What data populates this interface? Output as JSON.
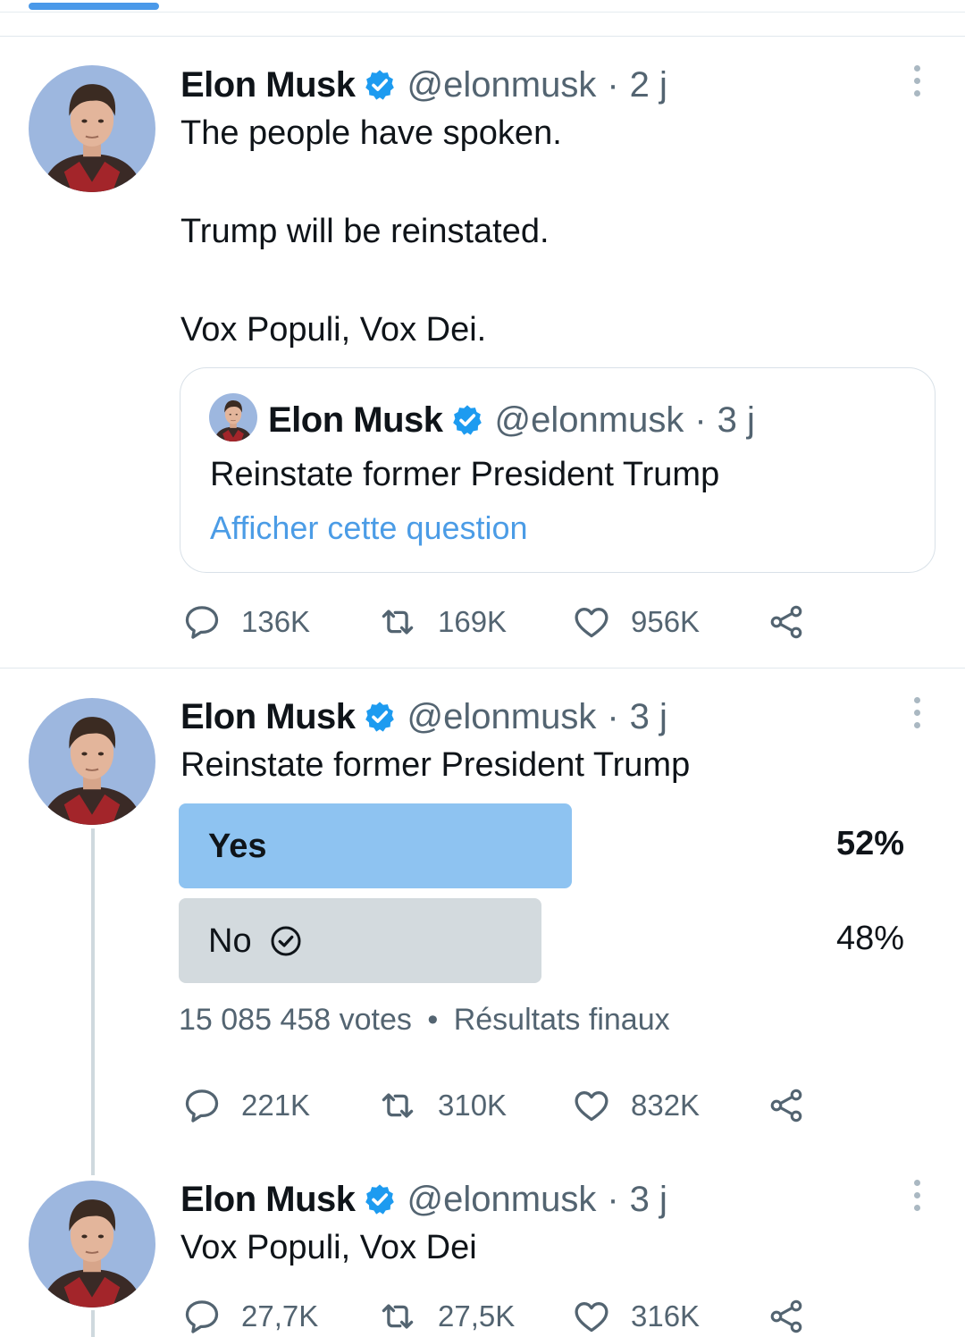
{
  "colors": {
    "accent": "#1d9bf0",
    "link": "#4b9ce6",
    "poll_winner": "#8ec3f1",
    "poll_other": "#d3dade",
    "muted": "#536471",
    "verified": "#1d9bf0"
  },
  "tweets": [
    {
      "name": "Elon Musk",
      "handle": "@elonmusk",
      "sep": "·",
      "time": "2 j",
      "lines": [
        "The people have spoken.",
        "Trump will be reinstated.",
        "Vox Populi, Vox Dei."
      ],
      "quote": {
        "name": "Elon Musk",
        "handle": "@elonmusk",
        "sep": "·",
        "time": "3 j",
        "text": "Reinstate former President Trump",
        "link": "Afficher cette question"
      },
      "actions": {
        "replies": "136K",
        "retweets": "169K",
        "likes": "956K"
      }
    },
    {
      "name": "Elon Musk",
      "handle": "@elonmusk",
      "sep": "·",
      "time": "3 j",
      "text": "Reinstate former President Trump",
      "poll": {
        "options": [
          {
            "label": "Yes",
            "percent": "52%",
            "share": 0.52,
            "winner": true
          },
          {
            "label": "No",
            "percent": "48%",
            "share": 0.48,
            "winner": false,
            "selected_icon": "check-circle-icon"
          }
        ],
        "votes": "15 085 458 votes",
        "bullet": "•",
        "status": "Résultats finaux"
      },
      "actions": {
        "replies": "221K",
        "retweets": "310K",
        "likes": "832K"
      }
    },
    {
      "name": "Elon Musk",
      "handle": "@elonmusk",
      "sep": "·",
      "time": "3 j",
      "text": "Vox Populi, Vox Dei",
      "actions": {
        "replies": "27,7K",
        "retweets": "27,5K",
        "likes": "316K"
      }
    }
  ]
}
